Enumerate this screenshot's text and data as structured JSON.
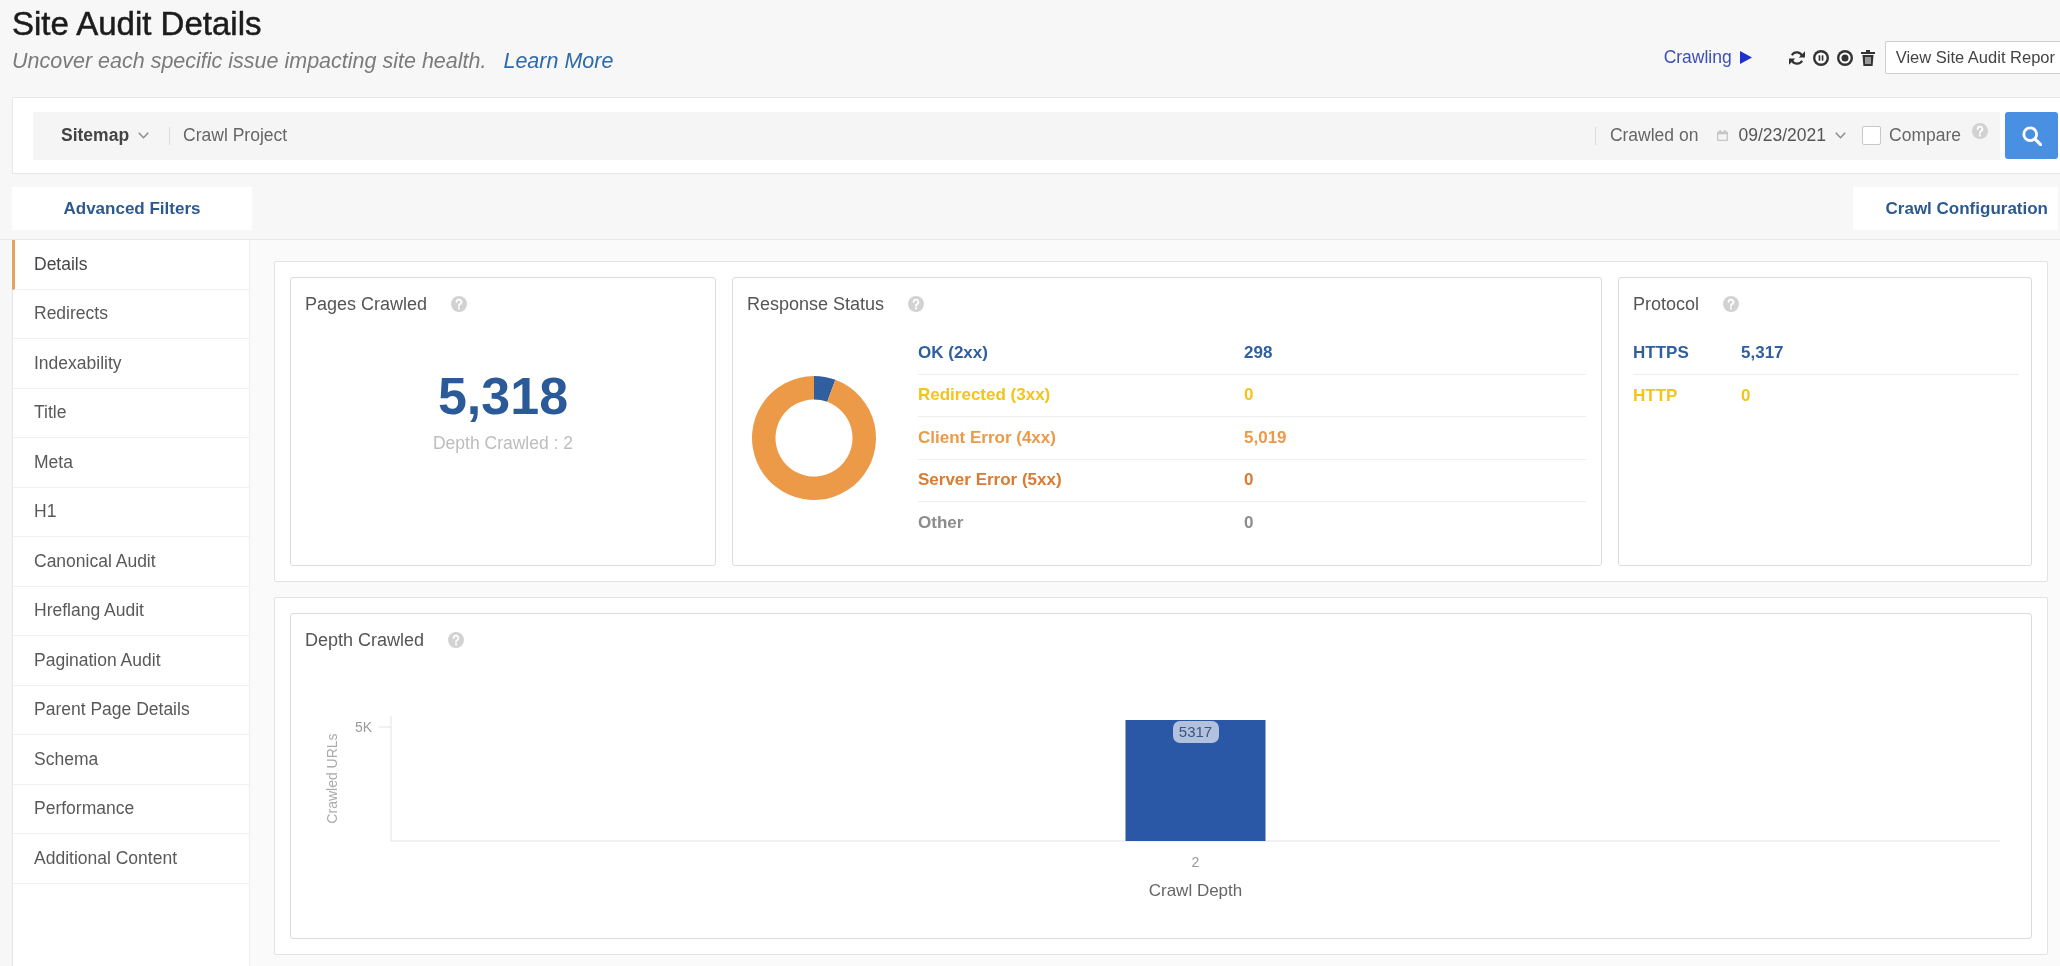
{
  "header": {
    "title": "Site Audit Details",
    "subtitle": "Uncover each specific issue impacting site health.",
    "learn_more_link": "Learn More"
  },
  "crawl_controls": {
    "status": "Crawling",
    "report_button": "View Site Audit Repor"
  },
  "filter_bar": {
    "source": "Sitemap",
    "project": "Crawl Project",
    "crawled_on_label": "Crawled on",
    "date": "09/23/2021",
    "compare": {
      "label": "Compare",
      "checked": false
    }
  },
  "actions": {
    "advanced_filters": "Advanced Filters",
    "crawl_configuration": "Crawl Configuration"
  },
  "sidebar": {
    "items": [
      {
        "label": "Details",
        "selected": true
      },
      {
        "label": "Redirects",
        "selected": false
      },
      {
        "label": "Indexability",
        "selected": false
      },
      {
        "label": "Title",
        "selected": false
      },
      {
        "label": "Meta",
        "selected": false
      },
      {
        "label": "H1",
        "selected": false
      },
      {
        "label": "Canonical Audit",
        "selected": false
      },
      {
        "label": "Hreflang Audit",
        "selected": false
      },
      {
        "label": "Pagination Audit",
        "selected": false
      },
      {
        "label": "Parent Page Details",
        "selected": false
      },
      {
        "label": "Schema",
        "selected": false
      },
      {
        "label": "Performance",
        "selected": false
      },
      {
        "label": "Additional Content",
        "selected": false
      }
    ]
  },
  "pages_crawled": {
    "title": "Pages Crawled",
    "count": "5,318",
    "depth_note": "Depth Crawled : 2"
  },
  "response_status": {
    "title": "Response Status",
    "chart_data": {
      "type": "donut",
      "values": [
        5.6,
        0,
        94.4,
        0,
        0
      ]
    },
    "rows": [
      {
        "label": "OK (2xx)",
        "value": "298",
        "color": "#2f5f9e"
      },
      {
        "label": "Redirected (3xx)",
        "value": "0",
        "color": "#f2c41c"
      },
      {
        "label": "Client Error (4xx)",
        "value": "5,019",
        "color": "#ec9a48"
      },
      {
        "label": "Server Error (5xx)",
        "value": "0",
        "color": "#db7a30"
      },
      {
        "label": "Other",
        "value": "0",
        "color": "#8c8c8c"
      }
    ]
  },
  "protocol": {
    "title": "Protocol",
    "rows": [
      {
        "label": "HTTPS",
        "value": "5,317",
        "color": "#2f5f9e"
      },
      {
        "label": "HTTP",
        "value": "0",
        "color": "#f2c41c"
      }
    ]
  },
  "depth_crawled": {
    "title": "Depth Crawled",
    "y_axis_title": "Crawled URLs",
    "y_tick_label": "5K",
    "bars": [
      {
        "category": "2",
        "label": "5317"
      }
    ],
    "x_axis_title": "Crawl Depth"
  }
}
